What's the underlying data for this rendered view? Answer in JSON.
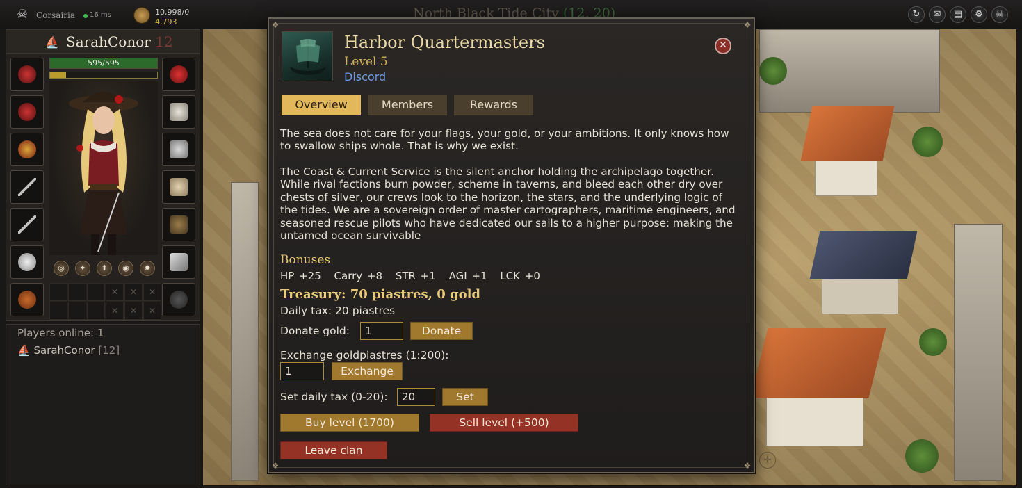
{
  "topbar": {
    "brand": "Corsairia",
    "ping": "16 ms",
    "piastres": "10,998/0",
    "gold": "4,793",
    "city_name": "North Black Tide City",
    "city_coords": "(12, 20)",
    "icons": [
      "refresh-icon",
      "chat-icon",
      "map-icon",
      "settings-icon",
      "logout-icon"
    ]
  },
  "character": {
    "name": "SarahConor",
    "level": "12",
    "hp": "595/595",
    "xp_fraction": 0.15
  },
  "players": {
    "title": "Players online: 1",
    "list": [
      {
        "name": "SarahConor",
        "level": "[12]"
      }
    ]
  },
  "clan": {
    "name": "Harbor Quartermasters",
    "level": "Level 5",
    "discord": "Discord",
    "tabs": [
      "Overview",
      "Members",
      "Rewards"
    ],
    "description_1": "The sea does not care for your flags, your gold, or your ambitions. It only knows how to swallow ships whole. That is why we exist.",
    "description_2": "The Coast & Current Service is the silent anchor holding the archipelago together. While rival factions burn powder, scheme in taverns, and bleed each other dry over chests of silver, our crews look to the horizon, the stars, and the underlying logic of the tides. We are a sovereign order of master cartographers, maritime engineers, and seasoned rescue pilots who have dedicated our sails to a higher purpose: making the untamed ocean survivable",
    "bonuses_title": "Bonuses",
    "bonuses": [
      "HP +25",
      "Carry +8",
      "STR +1",
      "AGI +1",
      "LCK +0"
    ],
    "treasury": "Treasury: 70 piastres, 0 gold",
    "daily_tax": "Daily tax: 20 piastres",
    "donate_label": "Donate gold:",
    "donate_value": "1",
    "donate_button": "Donate",
    "exchange_label": "Exchange goldpiastres (1:200):",
    "exchange_value": "1",
    "exchange_button": "Exchange",
    "tax_label": "Set daily tax (0-20):",
    "tax_value": "20",
    "tax_button": "Set",
    "buy_level": "Buy level (1700)",
    "sell_level": "Sell level (+500)",
    "leave_clan": "Leave clan"
  }
}
